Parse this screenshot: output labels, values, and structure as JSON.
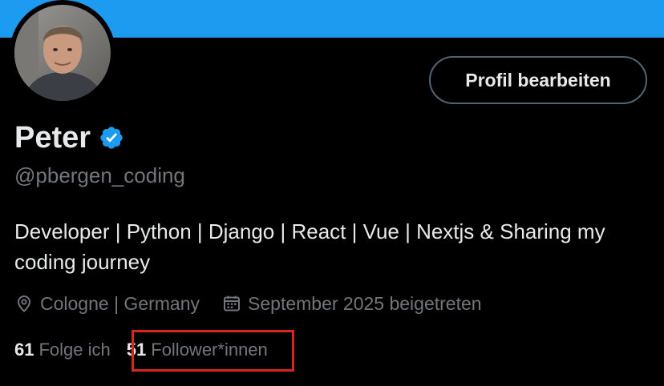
{
  "theme": {
    "banner_color": "#1d9bf0",
    "background": "#000000",
    "text_primary": "#e7e9ea",
    "text_secondary": "#71767b",
    "button_border": "#536471",
    "verified_color": "#1d9bf0",
    "highlight_color": "#d7261e"
  },
  "profile": {
    "display_name": "Peter",
    "verified_icon": "verified-badge-icon",
    "handle": "@pbergen_coding",
    "bio": "Developer | Python | Django | React | Vue | Nextjs & Sharing my coding journey",
    "location_icon": "location-pin-icon",
    "location": "Cologne | Germany",
    "joined_icon": "calendar-icon",
    "joined": "September 2025 beigetreten",
    "edit_button_label": "Profil bearbeiten"
  },
  "stats": {
    "following_count": "61",
    "following_label": "Folge ich",
    "followers_count": "51",
    "followers_label": "Follower*innen"
  }
}
